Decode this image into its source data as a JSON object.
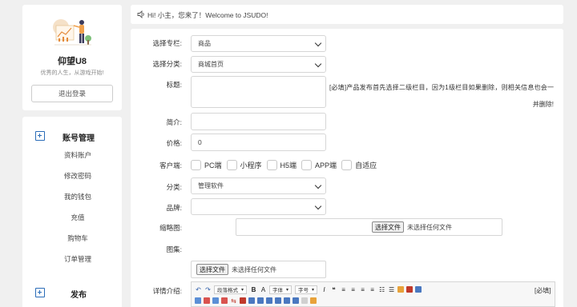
{
  "profile": {
    "name": "仰望U8",
    "motto": "优秀的人生，从游戏开始!",
    "logout_label": "退出登录"
  },
  "menu": {
    "sections": [
      {
        "title": "账号管理",
        "items": [
          "资料账户",
          "修改密码",
          "我的钱包",
          "充值",
          "购物车",
          "订单管理"
        ]
      },
      {
        "title": "发布",
        "items": []
      }
    ]
  },
  "notice": {
    "text": "Hi! 小主，您来了！Welcome to JSUDO!"
  },
  "form": {
    "column_label": "选择专栏:",
    "column_value": "商品",
    "category_label": "选择分类:",
    "category_value": "商城首页",
    "title_label": "标题:",
    "title_hint": "[必填]产品发布首先选择二级栏目，因为1级栏目如果删除，则相关信息也会一并删除!",
    "intro_label": "简介:",
    "intro_value": "",
    "price_label": "价格:",
    "price_value": "0",
    "client_label": "客户端:",
    "clients": [
      "PC端",
      "小程序",
      "H5端",
      "APP端",
      "自适应"
    ],
    "type_label": "分类:",
    "type_value": "管理软件",
    "brand_label": "品牌:",
    "brand_value": "",
    "thumb_label": "缩略图:",
    "file_button": "选择文件",
    "file_none": "未选择任何文件",
    "gallery_label": "图集:",
    "detail_label": "详情介绍:",
    "detail_required": "[必填]"
  },
  "editor": {
    "paragraph_format": "段落格式",
    "font_family": "字体",
    "font_size": "字号"
  },
  "colors": {
    "accent": "#2a6cb8",
    "background": "#f0f0f0"
  }
}
